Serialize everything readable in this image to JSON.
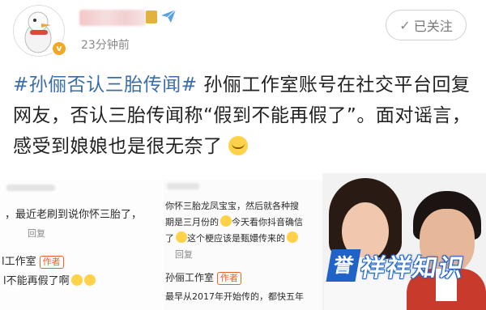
{
  "post": {
    "time": "23分钟前",
    "follow_label": "已关注",
    "topic": "#孙俪否认三胎传闻#",
    "text": " 孙俪工作室账号在社交平台回复网友，否认三胎传闻称“假到不能再假了”。面对谣言，感受到娘娘也是很无奈了"
  },
  "comment_shot_1": {
    "line1": "，最近老刷到说你怀三胎了，",
    "reply": "回复",
    "author": "l工作室",
    "author_tag": "作者",
    "line2": "l不能再假了啊"
  },
  "comment_shot_2": {
    "line1": "你怀三胎龙凤宝宝，然后就各种搜",
    "line2": "期是三月份的",
    "line2b": "今天看你抖音确信",
    "line3": "了",
    "line3b": "这个梗应该是甄嬛传来的",
    "reply": "回复",
    "author": "孙俪工作室",
    "author_tag": "作者",
    "line4": "最早从2017年开始传的，都快五年"
  },
  "watermark": {
    "box": "誉",
    "text": "祥祥知识"
  },
  "icons": {
    "avatar": "duck-avatar-icon",
    "verified": "verified-badge-icon",
    "send": "paper-plane-icon"
  },
  "colors": {
    "topic": "#3a6ea5",
    "watermark": "#1f63c9"
  }
}
